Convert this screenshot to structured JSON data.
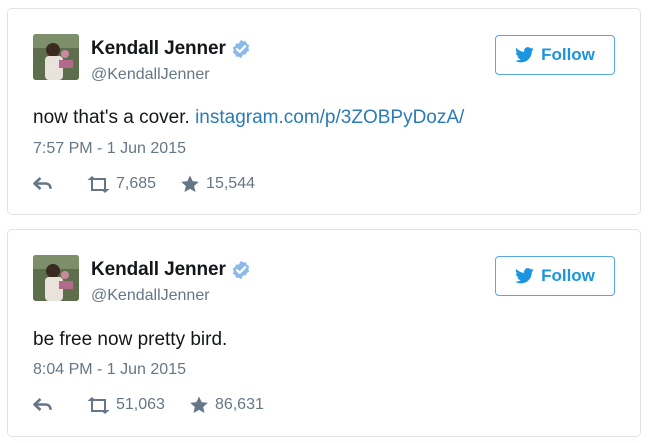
{
  "colors": {
    "link": "#2b7bb9",
    "follow": "#1b95e0",
    "verified": "#1da1f2",
    "muted": "#657786"
  },
  "tweets": [
    {
      "name": "Kendall Jenner",
      "handle": "@KendallJenner",
      "follow_label": "Follow",
      "text": "now that's a cover. ",
      "link": "instagram.com/p/3ZOBPyDozA/",
      "timestamp": "7:57 PM - 1 Jun 2015",
      "retweets": "7,685",
      "likes": "15,544"
    },
    {
      "name": "Kendall Jenner",
      "handle": "@KendallJenner",
      "follow_label": "Follow",
      "text": "be free now pretty bird.",
      "link": "",
      "timestamp": "8:04 PM - 1 Jun 2015",
      "retweets": "51,063",
      "likes": "86,631"
    }
  ]
}
